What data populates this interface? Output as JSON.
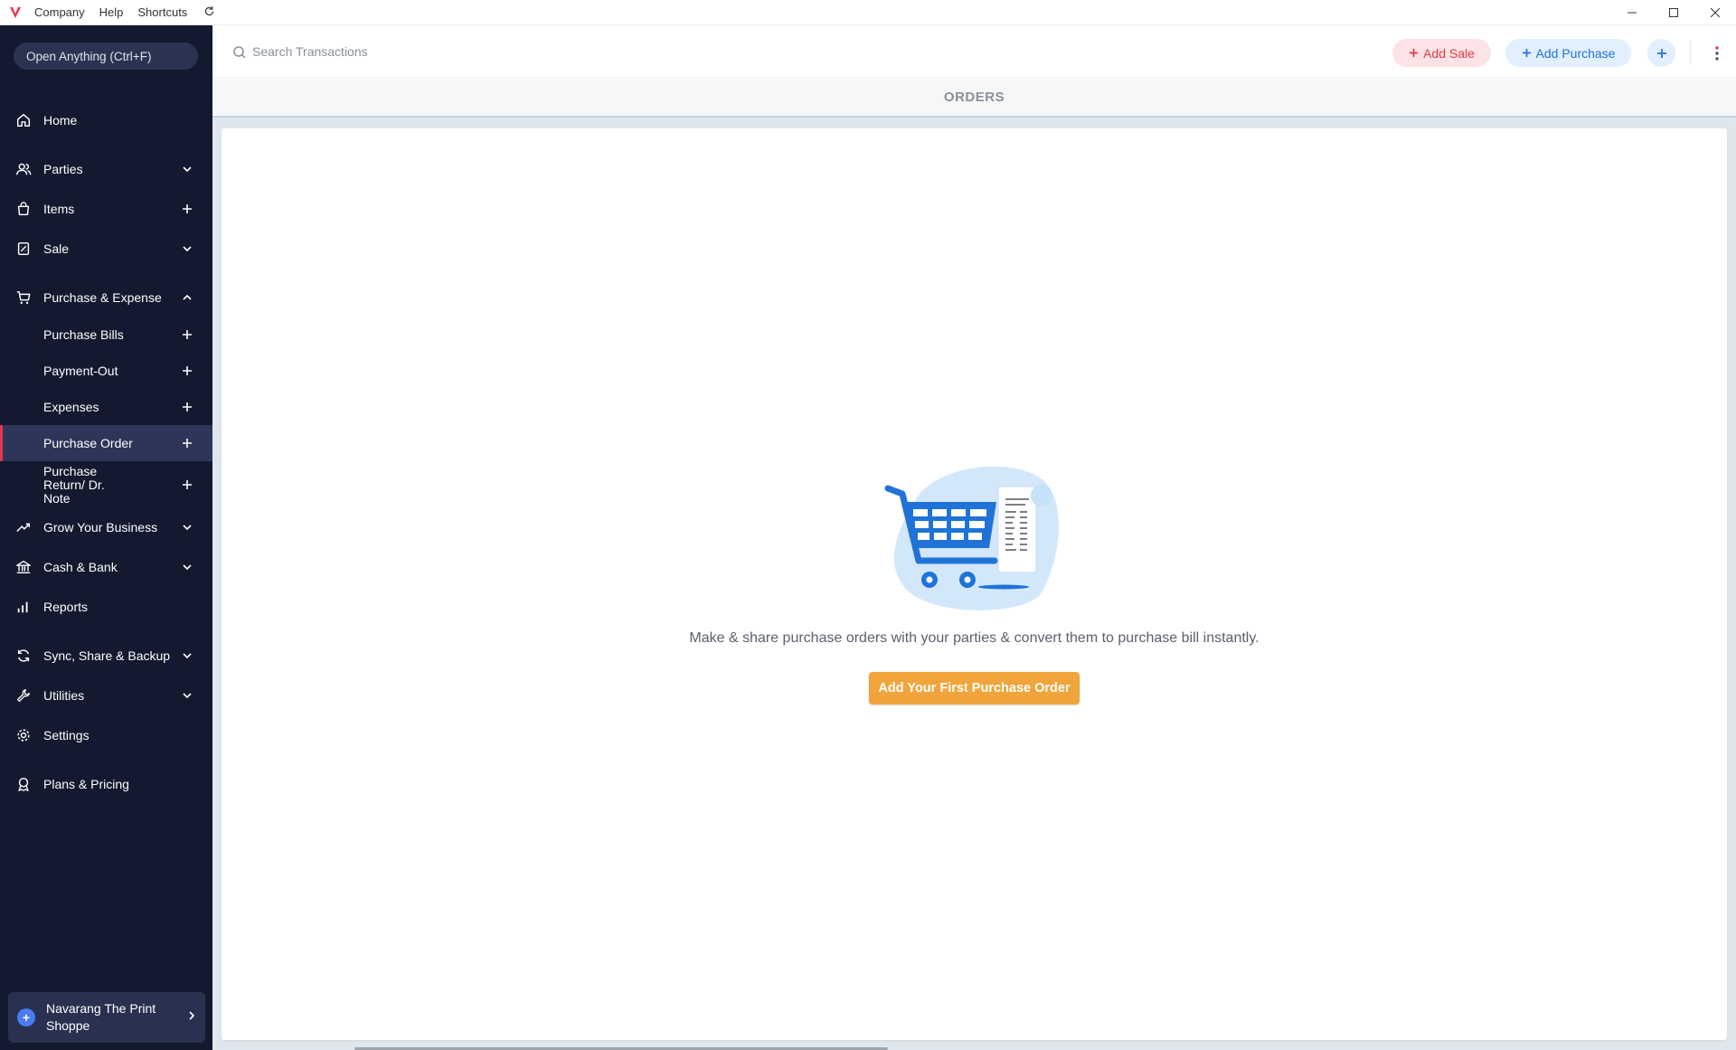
{
  "titlebar": {
    "menus": [
      "Company",
      "Help",
      "Shortcuts"
    ]
  },
  "sidebar": {
    "open_anything": "Open Anything (Ctrl+F)",
    "items": [
      {
        "label": "Home",
        "icon": "home-icon"
      },
      {
        "label": "Parties",
        "icon": "users-icon",
        "trail": "chevron-down"
      },
      {
        "label": "Items",
        "icon": "bag-icon",
        "trail": "plus"
      },
      {
        "label": "Sale",
        "icon": "receipt-icon",
        "trail": "chevron-down"
      },
      {
        "label": "Purchase & Expense",
        "icon": "cart-icon",
        "trail": "chevron-up"
      },
      {
        "label": "Grow Your Business",
        "icon": "trend-icon",
        "trail": "chevron-down"
      },
      {
        "label": "Cash & Bank",
        "icon": "bank-icon",
        "trail": "chevron-down"
      },
      {
        "label": "Reports",
        "icon": "bar-chart-icon"
      },
      {
        "label": "Sync, Share & Backup",
        "icon": "sync-icon",
        "trail": "chevron-down"
      },
      {
        "label": "Utilities",
        "icon": "wrench-icon",
        "trail": "chevron-down"
      },
      {
        "label": "Settings",
        "icon": "gear-icon"
      },
      {
        "label": "Plans & Pricing",
        "icon": "award-icon"
      }
    ],
    "purchase_sub": [
      {
        "label": "Purchase Bills"
      },
      {
        "label": "Payment-Out"
      },
      {
        "label": "Expenses"
      },
      {
        "label": "Purchase Order",
        "active": true
      },
      {
        "label": "Purchase Return/ Dr. Note"
      }
    ],
    "company": "Navarang The Print Shoppe"
  },
  "header": {
    "search_placeholder": "Search Transactions",
    "add_sale": "Add Sale",
    "add_purchase": "Add Purchase"
  },
  "page": {
    "title": "ORDERS",
    "empty_message": "Make & share purchase orders with your parties & convert them to purchase bill instantly.",
    "cta": "Add Your First Purchase Order"
  },
  "colors": {
    "sidebar_bg": "#13192e",
    "active_accent": "#e5364b",
    "cta": "#f0a43b",
    "sale": "#e53945",
    "purchase": "#1f73d8"
  }
}
